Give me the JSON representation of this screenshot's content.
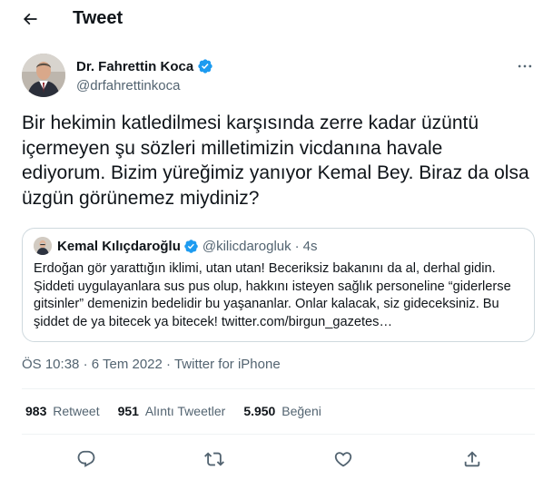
{
  "header": {
    "title": "Tweet",
    "back_icon": "arrow-left-icon"
  },
  "author": {
    "display_name": "Dr. Fahrettin Koca",
    "handle": "@drfahrettinkoca",
    "verified_icon": "verified-badge-icon",
    "more_icon": "more-horizontal-icon"
  },
  "tweet": {
    "text": "Bir hekimin katledilmesi karşısında zerre kadar üzüntü içermeyen şu sözleri milletimizin vicdanına havale ediyorum. Bizim yüreğimiz yanıyor Kemal Bey. Biraz da olsa üzgün görünemez miydiniz?"
  },
  "quote": {
    "display_name": "Kemal Kılıçdaroğlu",
    "handle": "@kilicdarogluk",
    "separator": "·",
    "time": "4s",
    "text": "Erdoğan gör yarattığın iklimi, utan utan! Beceriksiz bakanını da al, derhal gidin. Şiddeti uygulayanlara sus pus olup, hakkını isteyen sağlık personeline “giderlerse gitsinler” demenizin bedelidir bu yaşananlar. Onlar kalacak, siz gideceksiniz. Bu şiddet de ya bitecek ya bitecek! twitter.com/birgun_gazetes…"
  },
  "meta": {
    "time": "ÖS 10:38",
    "separator": "·",
    "date": "6 Tem 2022",
    "source": "Twitter for iPhone"
  },
  "stats": [
    {
      "count": "983",
      "label": "Retweet"
    },
    {
      "count": "951",
      "label": "Alıntı Tweetler"
    },
    {
      "count": "5.950",
      "label": "Beğeni"
    }
  ],
  "actions": [
    "reply-icon",
    "retweet-icon",
    "like-icon",
    "share-icon"
  ],
  "colors": {
    "text": "#0f1419",
    "secondary": "#536471",
    "verified": "#1d9bf0",
    "border": "#cfd9de",
    "divider": "#eff3f4"
  }
}
